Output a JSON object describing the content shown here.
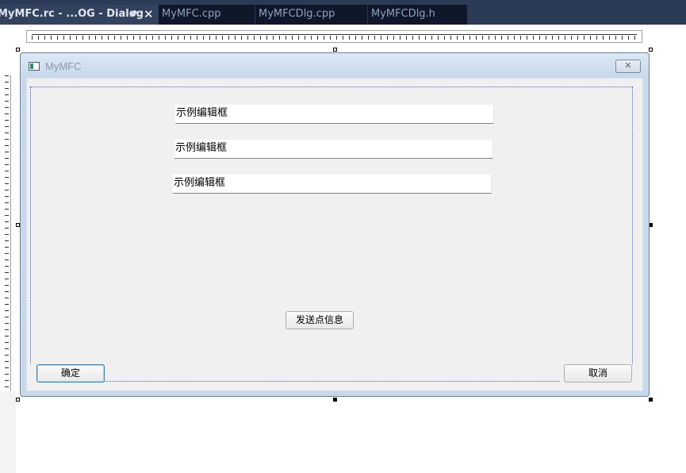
{
  "tabs": [
    {
      "label": "MyMFC.rc - ...OG - Dialog",
      "active": true
    },
    {
      "label": "MyMFC.cpp",
      "active": false
    },
    {
      "label": "MyMFCDlg.cpp",
      "active": false
    },
    {
      "label": "MyMFCDlg.h",
      "active": false
    }
  ],
  "tab_icons": {
    "pin": "pin-icon",
    "close": "close-icon"
  },
  "dialog": {
    "title": "MyMFC",
    "close_label": "✕",
    "edits": [
      "示例编辑框",
      "示例编辑框",
      "示例编辑框"
    ],
    "send_button": "发送点信息",
    "ok_button": "确定",
    "cancel_button": "取消"
  },
  "colors": {
    "tabbar": "#2b3a55",
    "inactive_tab": "#0f1728",
    "dialog_frame": "#c9d8ea",
    "client_bg": "#f0f0f0",
    "guide": "#5060b0"
  }
}
